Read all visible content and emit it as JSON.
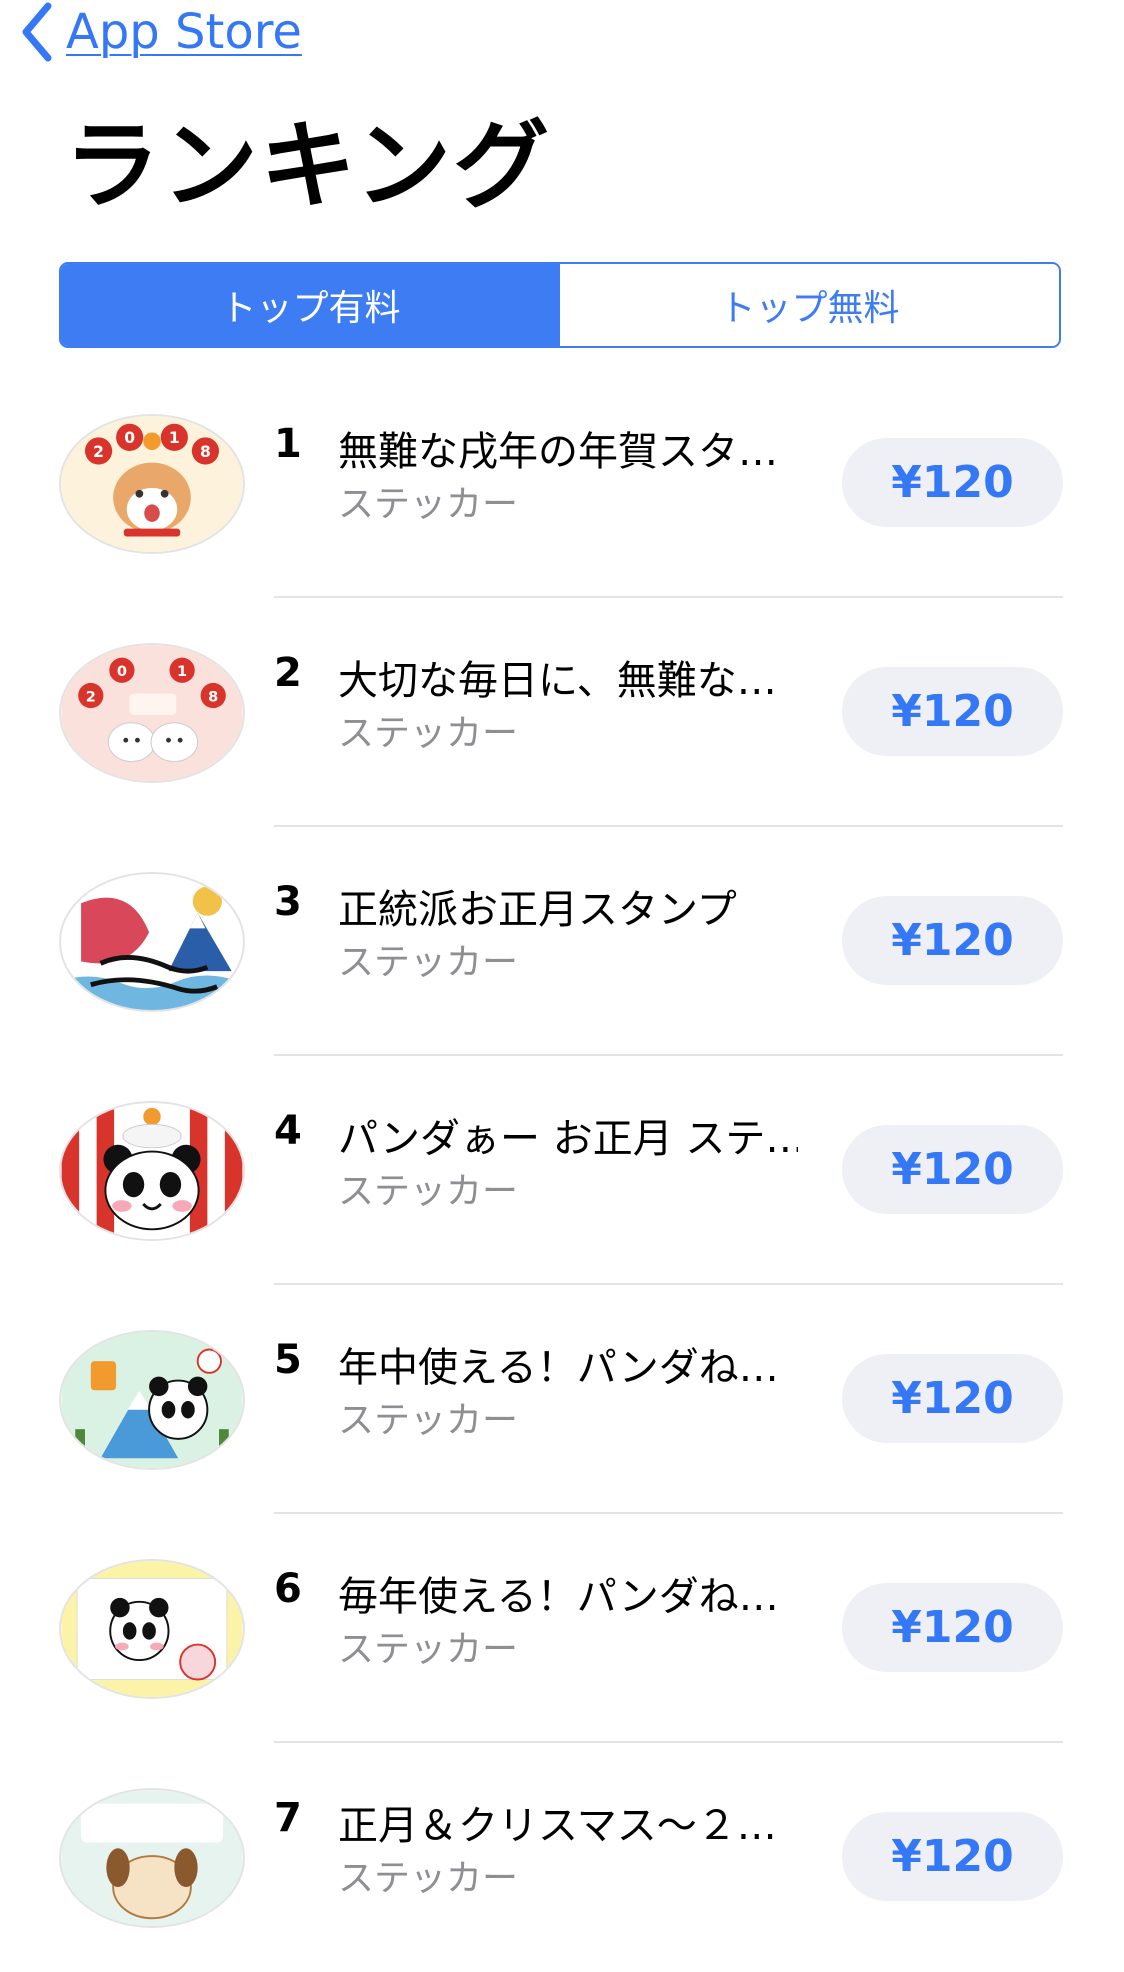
{
  "nav": {
    "back_label": "App Store"
  },
  "page_title": "ランキング",
  "segments": {
    "active_label": "トップ有料",
    "inactive_label": "トップ無料"
  },
  "items": [
    {
      "rank": "1",
      "name": "無難な戌年の年賀スタ…",
      "category": "ステッカー",
      "price": "¥120",
      "icon": "shiba-dog-2018-sticker-icon"
    },
    {
      "rank": "2",
      "name": "大切な毎日に、無難な…",
      "category": "ステッカー",
      "price": "¥120",
      "icon": "mochi-characters-2018-sticker-icon"
    },
    {
      "rank": "3",
      "name": "正統派お正月スタンプ",
      "category": "ステッカー",
      "price": "¥120",
      "icon": "sea-bream-fuji-sticker-icon"
    },
    {
      "rank": "4",
      "name": "パンダぁー お正月 ステ…",
      "category": "ステッカー",
      "price": "¥120",
      "icon": "panda-kagamimochi-sticker-icon"
    },
    {
      "rank": "5",
      "name": "年中使える！パンダね…",
      "category": "ステッカー",
      "price": "¥120",
      "icon": "panda-fuji-sticker-icon"
    },
    {
      "rank": "6",
      "name": "毎年使える！パンダね…",
      "category": "ステッカー",
      "price": "¥120",
      "icon": "panda-letter-sticker-icon"
    },
    {
      "rank": "7",
      "name": "正月＆クリスマス〜２…",
      "category": "ステッカー",
      "price": "¥120",
      "icon": "christmas-newyear-dog-sticker-icon"
    }
  ],
  "colors": {
    "accent": "#3478f6",
    "segment_active_bg": "#3d7cf2",
    "price_button_bg": "#eff0f5",
    "secondary_text": "#8e8e93"
  }
}
